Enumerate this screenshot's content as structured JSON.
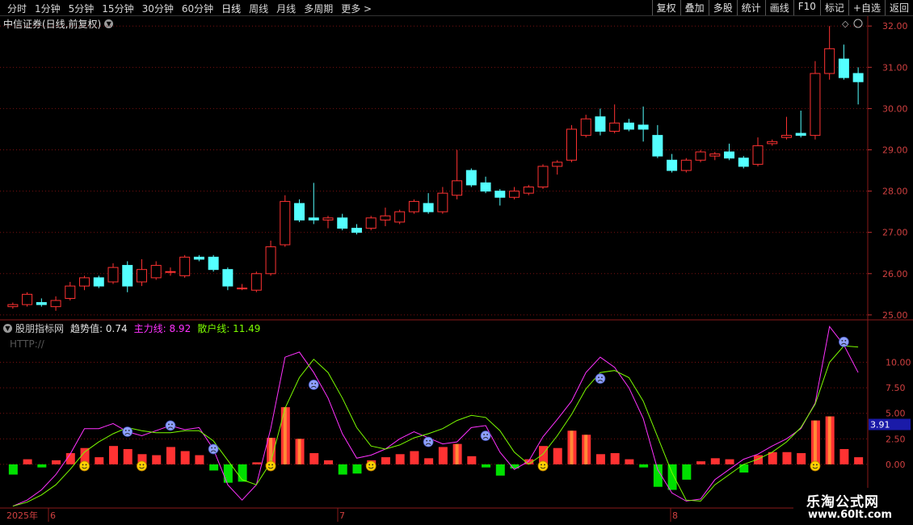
{
  "toolbar": {
    "periods": [
      "分时",
      "1分钟",
      "5分钟",
      "15分钟",
      "30分钟",
      "60分钟",
      "日线",
      "周线",
      "月线",
      "多周期",
      "更多 >"
    ],
    "active_period": "日线",
    "buttons": [
      "复权",
      "叠加",
      "多股",
      "统计",
      "画线",
      "F10",
      "标记",
      "+自选",
      "返回"
    ]
  },
  "stock": {
    "title": "中信证券(日线,前复权)"
  },
  "price_axis": {
    "labels": [
      "32.00",
      "31.00",
      "30.00",
      "29.00",
      "28.00",
      "27.00",
      "26.00",
      "25.00"
    ]
  },
  "indicator": {
    "name": "股朋指标网",
    "trend_label": "趋势值:",
    "trend_value": "0.74",
    "main_label": "主力线:",
    "main_value": "8.92",
    "retail_label": "散户线:",
    "retail_value": "11.49",
    "http_text": "HTTP://",
    "axis_labels": [
      "10.00",
      "7.50",
      "5.00",
      "2.50",
      "0.00"
    ],
    "current_tag": "3.91"
  },
  "time_axis": {
    "labels": [
      "2025年",
      "6",
      "7",
      "8"
    ]
  },
  "watermark": {
    "line1": "乐淘公式网",
    "line2": "www.60lt.com"
  },
  "colors": {
    "up": "#ff3232",
    "down": "#54ffff",
    "main_line": "#ff32ff",
    "retail_line": "#7cfc00",
    "grid": "#7a1010",
    "indicator_green": "#00e000"
  },
  "chart_data": {
    "type": "candlestick",
    "ylim": [
      24.9,
      32.2
    ],
    "candles": [
      [
        25.2,
        25.25,
        25.15,
        25.3
      ],
      [
        25.25,
        25.5,
        25.2,
        25.55
      ],
      [
        25.3,
        25.25,
        25.2,
        25.4
      ],
      [
        25.2,
        25.35,
        25.1,
        25.45
      ],
      [
        25.4,
        25.7,
        25.35,
        25.8
      ],
      [
        25.7,
        25.9,
        25.6,
        25.95
      ],
      [
        25.9,
        25.7,
        25.65,
        25.95
      ],
      [
        25.8,
        26.15,
        25.75,
        26.25
      ],
      [
        26.2,
        25.7,
        25.55,
        26.3
      ],
      [
        25.8,
        26.1,
        25.7,
        26.35
      ],
      [
        25.9,
        26.2,
        25.85,
        26.3
      ],
      [
        26.05,
        26.05,
        25.95,
        26.15
      ],
      [
        25.95,
        26.4,
        25.9,
        26.45
      ],
      [
        26.4,
        26.35,
        26.3,
        26.45
      ],
      [
        26.4,
        26.1,
        26.05,
        26.45
      ],
      [
        26.1,
        25.7,
        25.6,
        26.15
      ],
      [
        25.65,
        25.65,
        25.6,
        25.75
      ],
      [
        25.6,
        26.0,
        25.55,
        26.05
      ],
      [
        26.0,
        26.65,
        25.95,
        26.8
      ],
      [
        26.7,
        27.75,
        26.65,
        27.9
      ],
      [
        27.7,
        27.3,
        27.25,
        27.8
      ],
      [
        27.35,
        27.3,
        27.2,
        28.2
      ],
      [
        27.3,
        27.35,
        27.1,
        27.4
      ],
      [
        27.35,
        27.1,
        27.05,
        27.45
      ],
      [
        27.1,
        27.0,
        26.95,
        27.2
      ],
      [
        27.1,
        27.35,
        27.05,
        27.4
      ],
      [
        27.3,
        27.4,
        27.15,
        27.6
      ],
      [
        27.25,
        27.5,
        27.2,
        27.55
      ],
      [
        27.5,
        27.75,
        27.45,
        27.8
      ],
      [
        27.7,
        27.5,
        27.45,
        27.95
      ],
      [
        27.5,
        27.95,
        27.45,
        28.1
      ],
      [
        27.9,
        28.25,
        27.8,
        29.0
      ],
      [
        28.5,
        28.15,
        28.1,
        28.55
      ],
      [
        28.2,
        28.0,
        27.95,
        28.35
      ],
      [
        28.0,
        27.85,
        27.65,
        28.05
      ],
      [
        27.85,
        28.0,
        27.8,
        28.1
      ],
      [
        27.95,
        28.1,
        27.9,
        28.15
      ],
      [
        28.1,
        28.6,
        28.05,
        28.65
      ],
      [
        28.6,
        28.7,
        28.4,
        28.75
      ],
      [
        28.75,
        29.5,
        28.7,
        29.6
      ],
      [
        29.35,
        29.75,
        29.3,
        29.85
      ],
      [
        29.8,
        29.45,
        29.35,
        30.0
      ],
      [
        29.45,
        29.65,
        29.4,
        30.1
      ],
      [
        29.65,
        29.5,
        29.45,
        29.75
      ],
      [
        29.6,
        29.5,
        29.2,
        30.05
      ],
      [
        29.35,
        28.85,
        28.8,
        29.6
      ],
      [
        28.75,
        28.5,
        28.45,
        28.9
      ],
      [
        28.5,
        28.75,
        28.45,
        28.8
      ],
      [
        28.75,
        28.95,
        28.7,
        29.0
      ],
      [
        28.85,
        28.9,
        28.75,
        28.95
      ],
      [
        28.95,
        28.8,
        28.75,
        29.15
      ],
      [
        28.8,
        28.6,
        28.55,
        28.85
      ],
      [
        28.65,
        29.1,
        28.6,
        29.3
      ],
      [
        29.15,
        29.2,
        29.1,
        29.25
      ],
      [
        29.3,
        29.35,
        29.25,
        29.8
      ],
      [
        29.4,
        29.35,
        29.3,
        29.95
      ],
      [
        29.35,
        30.85,
        29.25,
        31.15
      ],
      [
        30.85,
        31.45,
        30.7,
        32.0
      ],
      [
        31.2,
        30.75,
        30.7,
        31.55
      ],
      [
        30.85,
        30.65,
        30.1,
        31.0
      ]
    ],
    "indicator": {
      "ylim": [
        -4.2,
        14.0
      ],
      "bars": [
        -1.0,
        0.5,
        -0.3,
        0.4,
        1.1,
        1.6,
        0.7,
        1.8,
        1.5,
        1.0,
        0.9,
        1.7,
        1.3,
        0.9,
        -0.6,
        -1.8,
        -1.7,
        0.2,
        2.6,
        5.6,
        2.5,
        1.1,
        0.4,
        -1.0,
        -0.9,
        0.4,
        0.7,
        1.0,
        1.3,
        0.6,
        1.7,
        2.0,
        0.8,
        -0.3,
        -1.1,
        -0.4,
        0.5,
        1.8,
        1.6,
        3.3,
        2.9,
        1.0,
        1.1,
        0.5,
        -0.3,
        -2.2,
        -2.5,
        -1.5,
        0.3,
        0.6,
        0.5,
        -0.8,
        0.9,
        1.2,
        1.2,
        1.1,
        4.3,
        4.7,
        1.5,
        0.7
      ],
      "main_line": [
        -4.1,
        -3.5,
        -2.5,
        -1.0,
        1.0,
        3.5,
        3.5,
        4.0,
        3.2,
        2.8,
        3.3,
        3.8,
        3.4,
        3.6,
        1.5,
        -2.0,
        -3.5,
        -2.0,
        3.5,
        10.5,
        11.0,
        9.0,
        6.5,
        3.0,
        0.6,
        0.9,
        1.5,
        2.5,
        3.2,
        2.6,
        2.0,
        2.2,
        3.6,
        3.8,
        1.2,
        -0.5,
        0.3,
        2.7,
        4.4,
        6.2,
        9.0,
        10.5,
        9.5,
        7.5,
        4.5,
        -0.5,
        -2.8,
        -3.6,
        -3.4,
        -1.5,
        -0.5,
        0.5,
        1.0,
        1.8,
        2.5,
        3.5,
        6.0,
        13.5,
        11.7,
        9.0
      ],
      "retail_line": [
        -4.1,
        -3.7,
        -3.0,
        -2.0,
        -0.5,
        1.2,
        2.2,
        3.0,
        3.6,
        3.3,
        3.1,
        3.1,
        3.3,
        3.3,
        2.3,
        0.4,
        -1.5,
        -2.0,
        0.2,
        5.5,
        8.5,
        10.3,
        9.0,
        6.5,
        3.6,
        1.8,
        1.5,
        1.9,
        2.6,
        3.0,
        3.5,
        4.3,
        4.8,
        4.6,
        3.3,
        1.2,
        0.0,
        1.0,
        2.8,
        4.9,
        7.4,
        9.0,
        9.2,
        8.5,
        6.2,
        2.7,
        -0.8,
        -3.5,
        -3.6,
        -2.0,
        -1.0,
        0.0,
        0.5,
        1.2,
        2.2,
        3.6,
        5.9,
        10.0,
        11.6,
        11.5
      ]
    }
  }
}
